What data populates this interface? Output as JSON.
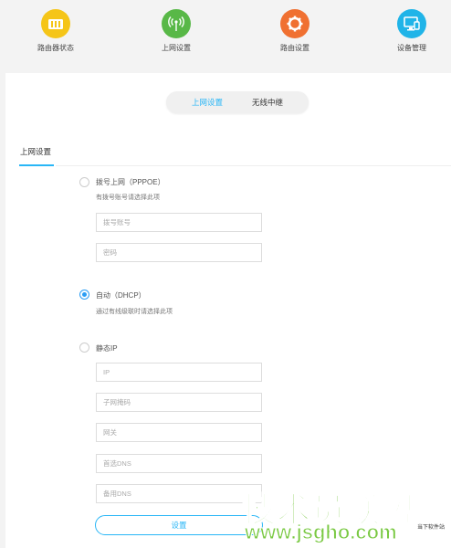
{
  "nav": {
    "items": [
      {
        "label": "路由器状态",
        "icon": "status-icon",
        "color": "#f5c518"
      },
      {
        "label": "上网设置",
        "icon": "wifi-antenna-icon",
        "color": "#58b847"
      },
      {
        "label": "路由设置",
        "icon": "gear-icon",
        "color": "#f07031"
      },
      {
        "label": "设备管理",
        "icon": "monitor-icon",
        "color": "#20b4e8"
      }
    ]
  },
  "subtabs": {
    "active": "上网设置",
    "other": "无线中继",
    "active_color": "#29b6f6"
  },
  "section": {
    "title": "上网设置"
  },
  "options": {
    "pppoe": {
      "label": "拨号上网（PPPOE）",
      "hint": "有拨号账号请选择此项",
      "account_placeholder": "拨号账号",
      "password_placeholder": "密码"
    },
    "dhcp": {
      "label": "自动（DHCP）",
      "hint": "通过有线级联时请选择此项",
      "checked": true
    },
    "static": {
      "label": "静态IP",
      "ip_placeholder": "IP",
      "mask_placeholder": "子网掩码",
      "gateway_placeholder": "网关",
      "dns1_placeholder": "首选DNS",
      "dns2_placeholder": "备用DNS"
    }
  },
  "submit_label": "设置",
  "watermark": {
    "main": "技术员联盟",
    "sub": "www.jsgho.com",
    "corner": "当下软件站"
  }
}
